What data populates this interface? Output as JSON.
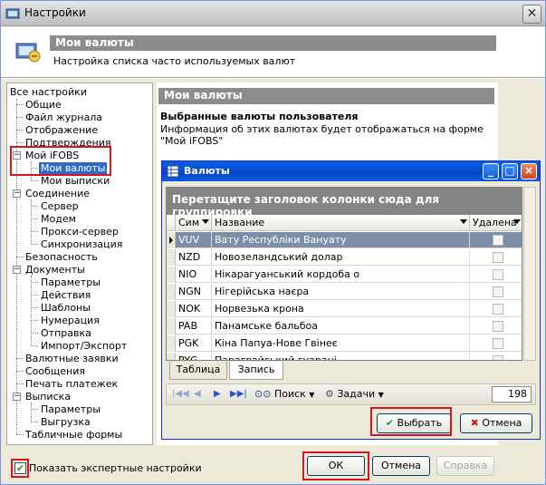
{
  "window": {
    "title": "Настройки",
    "close_label": "✕"
  },
  "header": {
    "title": "Мои валюты",
    "subtitle": "Настройка списка часто используемых валют"
  },
  "tree": {
    "root": "Все настройки",
    "items": [
      "Общие",
      "Файл журнала",
      "Отображение",
      "Подтверждения",
      "Мой iFOBS",
      "Мои валюты",
      "Мои выписки",
      "Соединение",
      "Сервер",
      "Модем",
      "Прокси-сервер",
      "Синхронизация",
      "Безопасность",
      "Документы",
      "Параметры",
      "Действия",
      "Шаблоны",
      "Нумерация",
      "Отправка",
      "Импорт/Экспорт",
      "Валютные заявки",
      "Сообщения",
      "Печать платежек",
      "Выписка",
      "Параметры",
      "Выгрузка",
      "Табличные формы"
    ]
  },
  "panel": {
    "title": "Мои валюты",
    "section": "Выбранные валюты пользователя",
    "info_line1": "Информация об этих валютах будет отображаться на форме",
    "info_line2": "\"Мой iFOBS\""
  },
  "dialog": {
    "title": "Валюты",
    "group_hint": "Перетащите заголовок колонки сюда для группировки",
    "columns": {
      "code": "Сим",
      "name": "Название",
      "deleted": "Удалена"
    },
    "rows": [
      {
        "code": "VUV",
        "name": "Вату Республіки Вануату"
      },
      {
        "code": "NZD",
        "name": "Новозеландський долар"
      },
      {
        "code": "NIO",
        "name": "Нікарагуанський кордоба о"
      },
      {
        "code": "NGN",
        "name": "Нігерійська наєра"
      },
      {
        "code": "NOK",
        "name": "Норвезька крона"
      },
      {
        "code": "PAB",
        "name": "Панамське бальбоа"
      },
      {
        "code": "PGK",
        "name": "Кіна Папуа-Нове Гвінеє"
      },
      {
        "code": "PYG",
        "name": "Парагвайський гуарані"
      }
    ],
    "tabs": {
      "table": "Таблица",
      "record": "Запись"
    },
    "toolbar": {
      "search": "Поиск",
      "tasks": "Задачи",
      "count": "198"
    },
    "buttons": {
      "select": "Выбрать",
      "cancel": "Отмена"
    }
  },
  "footer": {
    "expert_checkbox": "Показать экспертные настройки",
    "ok": "ОК",
    "cancel": "Отмена",
    "help": "Справка"
  }
}
